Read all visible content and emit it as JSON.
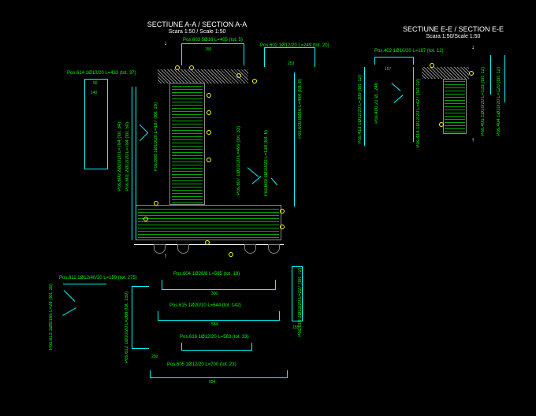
{
  "sectionA": {
    "title": "SECTIUNE A-A / SECTION A-A",
    "subtitle": "Scara 1:50 / Scale 1:50",
    "labels": {
      "pos603": "Pos.603 5Ø16 L=405 (tot. 5)",
      "pos602": "Pos.602 1Ø12/20 L=249 (tot. 20)",
      "pos614": "Pos.614 1Ø10/20 L=432 (tot. 37)",
      "pos600": "Pos.600 2Ø20/20 L=784 (tot. 34)",
      "pos601": "Pos.601 2Ø12/20 L=784 (tot. 50)",
      "pos608": "Pos.608 1Ø10/20 L=187 (tot. 16)",
      "pos606": "Pos.606 8Ø16 L=484 (tot. 8)",
      "pos607": "Pos.607 1Ø10/20 L=499 (tot. 33)",
      "pos609": "Pos.609 1Ø10/20 L=138 (tot. 6)",
      "pos613": "Pos.613 1Ø8/165 L=28 (tot. 16)",
      "pos611": "Pos.611 1Ø12/40/20 L=159 (tot. 275)",
      "pos612": "Pos.612 1Ø10/20 L=268 (tot. 159)",
      "pos610": "Pos.610 2Ø12/20 L=227 (tot. 72)",
      "pos604": "Pos.604 1Ø28/8 L=585 (tot. 19)",
      "pos615": "Pos.615 1Ø20/10 L=644 (tot. 142)",
      "pos616": "Pos.616 1Ø12/20 L=583 (tot. 33)",
      "pos605": "Pos.605 1Ø12/20 L=700 (tot. 23)"
    },
    "dims": {
      "d253": "253",
      "d150": "150",
      "d140": "140",
      "d56": "56",
      "d300": "300",
      "d584": "584",
      "d654": "654",
      "d155": "155"
    }
  },
  "sectionE": {
    "title": "SECTIUNE E-E / SECTION E-E",
    "subtitle": "Scara 1:50/Scale 1:50",
    "labels": {
      "pos402": "Pos.402 1Ø10/20 L=167 (tot. 12)",
      "pos413": "Pos.413 1Ø12/20 L=389 (tot. 12)",
      "pos400": "Pos.400 21 Ø...248",
      "pos414": "Pos.414 1Ø12/20 L=427 (tot. 12)",
      "pos405": "Pos.405 1Ø10/20 L=133 (tot. 12)",
      "pos404": "Pos.404 1Ø10/20 L=120 (tot. 12)"
    },
    "dims": {
      "d157": "157"
    }
  }
}
